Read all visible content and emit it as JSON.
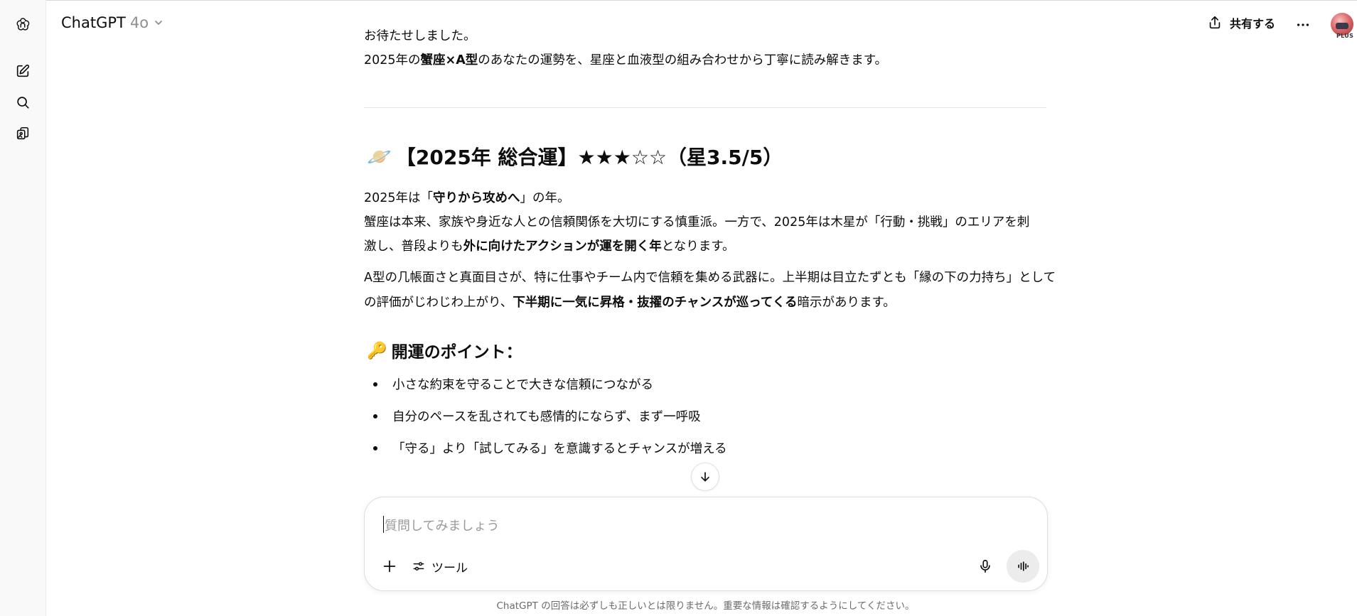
{
  "app": {
    "model_name": "ChatGPT",
    "model_version": "4o",
    "share_label": "共有する",
    "plan_badge": "PLUS"
  },
  "message": {
    "intro_line1": "お待たせしました。",
    "intro_line2": {
      "pre": "2025年の",
      "bold": "蟹座×A型",
      "post": "のあなたの運勢を、星座と血液型の組み合わせから丁寧に読み解きます。"
    },
    "section1_heading": {
      "emoji": "🪐",
      "text": "【2025年 総合運】★★★☆☆（星3.5/5）"
    },
    "para1": {
      "pre": "2025年は「",
      "bold": "守りから攻めへ",
      "post": "」の年。"
    },
    "para2": {
      "line1": "蟹座は本来、家族や身近な人との信頼関係を大切にする慎重派。一方で、2025年は木星が「行動・挑戦」のエリアを刺",
      "line2_pre": "激し、普段よりも",
      "line2_bold": "外に向けたアクションが運を開く年",
      "line2_post": "となります。"
    },
    "para3": {
      "line1": "A型の几帳面さと真面目さが、特に仕事やチーム内で信頼を集める武器に。上半期は目立たずとも「縁の下の力持ち」として",
      "line2_pre": "の評価がじわじわ上がり、",
      "line2_bold": "下半期に一気に昇格・抜擢のチャンスが巡ってくる",
      "line2_post": "暗示があります。"
    },
    "section2_heading": {
      "emoji": "🔑",
      "text": "開運のポイント："
    },
    "points": [
      "小さな約束を守ることで大きな信頼につながる",
      "自分のペースを乱されても感情的にならず、まず一呼吸",
      "「守る」より「試してみる」を意識するとチャンスが増える"
    ]
  },
  "composer": {
    "placeholder": "質問してみましょう",
    "tools_label": "ツール"
  },
  "footer": {
    "disclaimer": "ChatGPT の回答は必ずしも正しいとは限りません。重要な情報は確認するようにしてください。"
  }
}
